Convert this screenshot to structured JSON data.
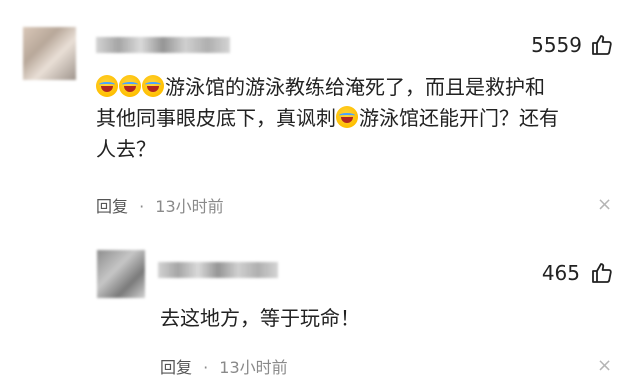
{
  "comments": [
    {
      "likes": "5559",
      "text_line1": "游泳馆的游泳教练给淹死了，而且是救护和",
      "text_line2a": "其他同事眼皮底下，真讽刺",
      "text_line2b": "游泳馆还能开门？还有",
      "text_line3": "人去？",
      "reply_label": "回复",
      "separator": "·",
      "time": "13小时前",
      "close_glyph": "×"
    },
    {
      "likes": "465",
      "text": "去这地方，等于玩命！",
      "reply_label": "回复",
      "separator": "·",
      "time": "13小时前",
      "close_glyph": "×"
    }
  ],
  "icons": {
    "like": "thumbs-up-icon",
    "emoji": "laughing-crying-emoji",
    "close": "close-icon"
  },
  "colors": {
    "text": "#222222",
    "meta": "#8a8a8a",
    "close": "#b5b5b5"
  }
}
